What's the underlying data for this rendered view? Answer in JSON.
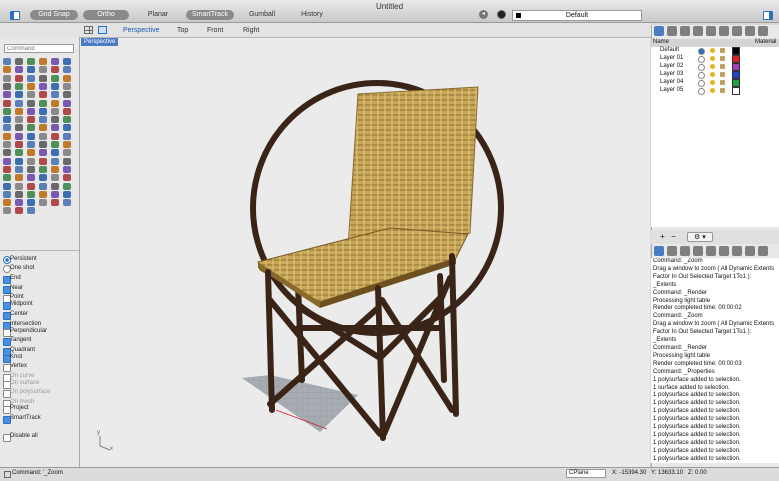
{
  "window": {
    "title": "Untitled"
  },
  "toolbar": {
    "grid_snap": "Grid Snap",
    "ortho": "Ortho",
    "planar": "Planar",
    "smarttrack": "SmartTrack",
    "gumball": "Gumball",
    "history": "History",
    "layer_select": "Default"
  },
  "view_tabs": [
    "Perspective",
    "Top",
    "Front",
    "Right"
  ],
  "viewport": {
    "label": "Perspective"
  },
  "command_input": {
    "placeholder": "Command"
  },
  "osnap": {
    "persistent": "Persistent",
    "one_shot": "One shot",
    "items": [
      {
        "label": "End",
        "checked": true,
        "dim": false
      },
      {
        "label": "Near",
        "checked": true,
        "dim": false
      },
      {
        "label": "Point",
        "checked": false,
        "dim": false
      },
      {
        "label": "Midpoint",
        "checked": true,
        "dim": false
      },
      {
        "label": "Center",
        "checked": true,
        "dim": false
      },
      {
        "label": "Intersection",
        "checked": true,
        "dim": false
      },
      {
        "label": "Perpendicular",
        "checked": false,
        "dim": false
      },
      {
        "label": "Tangent",
        "checked": true,
        "dim": false
      },
      {
        "label": "Quadrant",
        "checked": true,
        "dim": false
      },
      {
        "label": "Knot",
        "checked": true,
        "dim": false
      },
      {
        "label": "Vertex",
        "checked": false,
        "dim": false
      },
      {
        "label": "On curve",
        "checked": false,
        "dim": true
      },
      {
        "label": "On surface",
        "checked": false,
        "dim": true
      },
      {
        "label": "On polysurface",
        "checked": false,
        "dim": true
      },
      {
        "label": "On mesh",
        "checked": false,
        "dim": true
      },
      {
        "label": "Project",
        "checked": false,
        "dim": false
      },
      {
        "label": "SmartTrack",
        "checked": true,
        "dim": false
      }
    ],
    "disable_all": "Disable all"
  },
  "layers": {
    "col_name": "Name",
    "col_material": "Material",
    "rows": [
      {
        "name": "Default",
        "color": "#000000"
      },
      {
        "name": "Layer 01",
        "color": "#e02020"
      },
      {
        "name": "Layer 02",
        "color": "#a040c0"
      },
      {
        "name": "Layer 03",
        "color": "#2040d0"
      },
      {
        "name": "Layer 04",
        "color": "#20a040"
      },
      {
        "name": "Layer 05",
        "color": "#ffffff"
      }
    ],
    "add": "+",
    "remove": "−",
    "gear": "⚙ ▾"
  },
  "history_lines": [
    "Command: _Zoom",
    "Drag a window to zoom ( All Dynamic Extents",
    "Factor In Out Selected Target 1To1 ):",
    "_Extents",
    "Command: _Render",
    "Processing light table",
    "Render completed time: 00:00:02",
    "Command: _Zoom",
    "Drag a window to zoom ( All Dynamic Extents",
    "Factor In Out Selected Target 1To1 ):",
    "_Extents",
    "Command: _Render",
    "Processing light table",
    "Render completed time: 00:00:03",
    "Command: _Properties",
    "1 polysurface added to selection.",
    "1 surface added to selection.",
    "1 polysurface added to selection.",
    "1 polysurface added to selection.",
    "1 polysurface added to selection.",
    "1 polysurface added to selection.",
    "1 polysurface added to selection.",
    "1 polysurface added to selection.",
    "1 polysurface added to selection.",
    "1 polysurface added to selection.",
    "1 polysurface added to selection.",
    "1 polysurface added to selection.",
    "1 polysurface added to selection.",
    "Command: _Zoom"
  ],
  "status": {
    "command": "Command: '_Zoom",
    "cplane": "CPlane",
    "x": "X: -15394.30",
    "y": "Y: 13633.10",
    "z": "Z: 0.00"
  },
  "axis": {
    "y": "y",
    "x": "x"
  }
}
